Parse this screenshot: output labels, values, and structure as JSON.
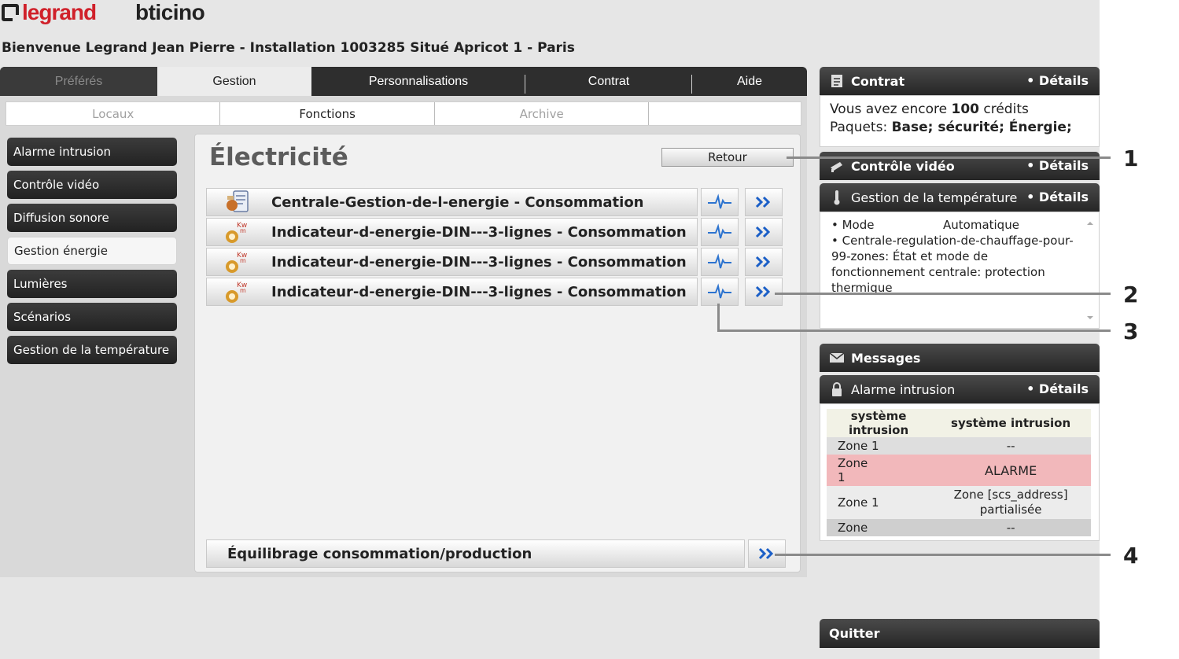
{
  "header": {
    "logo_left": "legrand",
    "logo_right": "bticino",
    "welcome": "Bienvenue Legrand Jean Pierre - Installation 1003285 Situé Apricot 1 - Paris"
  },
  "main_tabs": [
    {
      "label": "Préférés",
      "state": "disabled"
    },
    {
      "label": "Gestion",
      "state": "active"
    },
    {
      "label": "Personnalisations",
      "state": "normal"
    },
    {
      "label": "Contrat",
      "state": "normal"
    },
    {
      "label": "Aide",
      "state": "normal"
    }
  ],
  "sub_tabs": [
    {
      "label": "Locaux",
      "state": "disabled"
    },
    {
      "label": "Fonctions",
      "state": "active"
    },
    {
      "label": "Archive",
      "state": "disabled"
    }
  ],
  "sidebar": {
    "items": [
      {
        "label": "Alarme intrusion"
      },
      {
        "label": "Contrôle vidéo"
      },
      {
        "label": "Diffusion sonore"
      },
      {
        "label": "Gestion énergie",
        "active": true
      },
      {
        "label": "Lumières"
      },
      {
        "label": "Scénarios"
      },
      {
        "label": "Gestion de la température"
      }
    ]
  },
  "main": {
    "title": "Électricité",
    "retour_label": "Retour",
    "functions": [
      {
        "label": "Centrale-Gestion-de-l-energie - Consommation",
        "icon": "energy-central-icon"
      },
      {
        "label": "Indicateur-d-energie-DIN---3-lignes - Consommation",
        "icon": "energy-meter-icon"
      },
      {
        "label": "Indicateur-d-energie-DIN---3-lignes - Consommation",
        "icon": "energy-meter-icon"
      },
      {
        "label": "Indicateur-d-energie-DIN---3-lignes - Consommation",
        "icon": "energy-meter-icon"
      }
    ],
    "meter_icon_text": "Kw",
    "balance_label": "Équilibrage consommation/production"
  },
  "widgets": {
    "contrat": {
      "title": "Contrat",
      "details": "• Détails",
      "credits_prefix": "Vous avez encore",
      "credits_value": "100",
      "credits_suffix": "crédits",
      "packages_label": "Paquets:",
      "packages_value": "Base; sécurité; Énergie;"
    },
    "video": {
      "title": "Contrôle vidéo",
      "details": "• Détails"
    },
    "temperature": {
      "title": "Gestion de la température",
      "details": "• Détails",
      "mode_label": "• Mode",
      "mode_value": "Automatique",
      "central_text": "• Centrale-regulation-de-chauffage-pour-99-zones: État et mode de fonctionnement centrale: protection thermique"
    },
    "messages": {
      "title": "Messages"
    },
    "alarm": {
      "title": "Alarme intrusion",
      "details": "• Détails",
      "headers": [
        "système intrusion",
        "système intrusion"
      ],
      "rows": [
        {
          "zone": "Zone 1",
          "state": "--",
          "style": "zebra"
        },
        {
          "zone": "Zone 1",
          "state": "ALARME",
          "style": "alarm"
        },
        {
          "zone": "Zone 1",
          "state": "Zone [scs_address] partialisée",
          "style": "white"
        },
        {
          "zone": "Zone",
          "state": "--",
          "style": "zebra"
        }
      ]
    },
    "quit_label": "Quitter"
  },
  "callouts": [
    "1",
    "2",
    "3",
    "4"
  ],
  "colors": {
    "brand_red": "#d0202a",
    "header_dark": "#2e2e2e",
    "alarm_pink": "#f2b8bb",
    "accent_blue": "#1b5fc7"
  }
}
